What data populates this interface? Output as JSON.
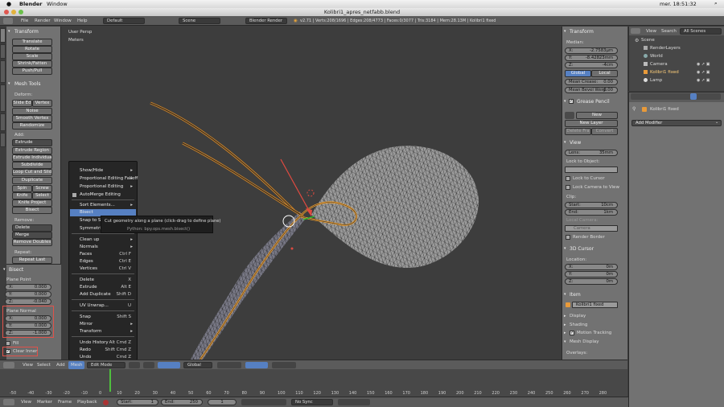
{
  "mac": {
    "app": "Blender",
    "menu_window": "Window",
    "title": "Kolibri1_apres_netfabb.blend",
    "clock": "mer. 18:51:32"
  },
  "info": {
    "menu": [
      "File",
      "Render",
      "Window",
      "Help"
    ],
    "layout": "Default",
    "scene": "Scene",
    "engine": "Blender Render",
    "stats": "v2.71 | Verts:208/1696 | Edges:208/4773 | Faces:0/3077 | Tris:3184 | Mem:28.13M | Kolibri1 fixed"
  },
  "vtabs": [
    "Tools",
    "Create",
    "Relations",
    "Shading / UVs",
    "Options",
    "Grease Pencil"
  ],
  "tool": {
    "transform_hdr": "Transform",
    "transform": [
      "Translate",
      "Rotate",
      "Scale",
      "Shrink/Fatten",
      "Push/Pull"
    ],
    "mesh_hdr": "Mesh Tools",
    "deform": "Deform:",
    "slide_edge": "Slide Ed",
    "vertex": "Vertex",
    "noise": "Noise",
    "smooth": "Smooth Vertex",
    "randomize": "Randomize",
    "add": "Add:",
    "extrude": "Extrude",
    "extrude_region": "Extrude Region",
    "extrude_individual": "Extrude Individual",
    "subdivide": "Subdivide",
    "loop_cut": "Loop Cut and Slide",
    "duplicate": "Duplicate",
    "spin": "Spin",
    "screw": "Screw",
    "knife": "Knife",
    "select": "Select",
    "knife_project": "Knife Project",
    "bisect": "Bisect",
    "remove": "Remove:",
    "delete": "Delete",
    "merge": "Merge",
    "remove_doubles": "Remove Doubles",
    "repeat": "Repeat:",
    "repeat_last": "Repeat Last"
  },
  "bisect": {
    "hdr": "Bisect",
    "plane_point": "Plane Point",
    "pp": [
      {
        "k": "X:",
        "v": "0.000"
      },
      {
        "k": "Y:",
        "v": "0.000"
      },
      {
        "k": "Z:",
        "v": "-0.040"
      }
    ],
    "plane_normal": "Plane Normal",
    "pn": [
      {
        "k": "X:",
        "v": "0.000"
      },
      {
        "k": "Y:",
        "v": "0.000"
      },
      {
        "k": "Z:",
        "v": "-1.000"
      }
    ],
    "fill": "Fill",
    "clear_inner": "Clear Inner"
  },
  "viewport": {
    "persp": "User Persp",
    "units": "Meters"
  },
  "menu": {
    "items": [
      {
        "label": "Show/Hide",
        "sc": "",
        "ar": "▸"
      },
      {
        "label": "Proportional Editing Falloff",
        "sc": "",
        "ar": "▸"
      },
      {
        "label": "Proportional Editing",
        "sc": "",
        "ar": "▸"
      },
      {
        "label": "AutoMerge Editing",
        "sc": "",
        "ar": ""
      },
      {
        "label": "Sort Elements...",
        "sc": "",
        "ar": "▸"
      },
      {
        "label": "Bisect",
        "sc": "",
        "ar": ""
      },
      {
        "label": "Snap to S",
        "sc": "",
        "ar": ""
      },
      {
        "label": "Symmetri",
        "sc": "",
        "ar": ""
      },
      {
        "label": "Clean up",
        "sc": "",
        "ar": "▸"
      },
      {
        "label": "Normals",
        "sc": "",
        "ar": "▸"
      },
      {
        "label": "Faces",
        "sc": "Ctrl F",
        "ar": ""
      },
      {
        "label": "Edges",
        "sc": "Ctrl E",
        "ar": ""
      },
      {
        "label": "Vertices",
        "sc": "Ctrl V",
        "ar": ""
      },
      {
        "label": "Delete",
        "sc": "X",
        "ar": ""
      },
      {
        "label": "Extrude",
        "sc": "Alt E",
        "ar": ""
      },
      {
        "label": "Add Duplicate",
        "sc": "Shift D",
        "ar": ""
      },
      {
        "label": "UV Unwrap...",
        "sc": "U",
        "ar": ""
      },
      {
        "label": "Snap",
        "sc": "Shift S",
        "ar": ""
      },
      {
        "label": "Mirror",
        "sc": "",
        "ar": "▸"
      },
      {
        "label": "Transform",
        "sc": "",
        "ar": "▸"
      },
      {
        "label": "Undo History",
        "sc": "Alt Cmd Z",
        "ar": ""
      },
      {
        "label": "Redo",
        "sc": "Shift Cmd Z",
        "ar": ""
      },
      {
        "label": "Undo",
        "sc": "Cmd Z",
        "ar": ""
      }
    ],
    "tooltip": "Cut geometry along a plane (click-drag to define plane)",
    "tooltip_python": "Python: bpy.ops.mesh.bisect()"
  },
  "v3dheader": {
    "view": "View",
    "select": "Select",
    "add": "Add",
    "mesh": "Mesh",
    "mode": "Edit Mode",
    "orientation": "Global"
  },
  "props": {
    "transform_hdr": "Transform",
    "median": "Median:",
    "x": {
      "k": "X:",
      "v": "-2.7583µm"
    },
    "y": {
      "k": "Y:",
      "v": "-8.42823mm"
    },
    "z": {
      "k": "Z:",
      "v": "-4cm"
    },
    "global": "Global",
    "local": "Local",
    "crease": {
      "k": "Mean Crease:",
      "v": "0.00"
    },
    "bevel": {
      "k": "Mean Bevel Weig:",
      "v": "0.00"
    },
    "gp_hdr": "Grease Pencil",
    "new": "New",
    "new_layer": "New Layer",
    "delete_fra": "Delete Fra",
    "convert": "Convert",
    "view_hdr": "View",
    "lens": {
      "k": "Lens:",
      "v": "35mm"
    },
    "lock_obj": "Lock to Object:",
    "lock_cursor": "Lock to Cursor",
    "lock_cam": "Lock Camera to View",
    "clip": "Clip:",
    "start": {
      "k": "Start:",
      "v": "10cm"
    },
    "end": {
      "k": "End:",
      "v": "1km"
    },
    "local_camera": "Local Camera:",
    "camera": "Camera",
    "render_border": "Render Border",
    "cursor_hdr": "3D Cursor",
    "location": "Location:",
    "cx": {
      "k": "X:",
      "v": "0m"
    },
    "cy": {
      "k": "Y:",
      "v": "0m"
    },
    "cz": {
      "k": "Z:",
      "v": "0m"
    },
    "item_hdr": "Item",
    "item_name": "Kolibri1 fixed",
    "display": "Display",
    "shading": "Shading",
    "motion": "Motion Tracking",
    "mesh_display": "Mesh Display",
    "overlays": "Overlays:"
  },
  "outliner": {
    "view": "View",
    "search": "Search",
    "all_scenes": "All Scenes",
    "items": [
      "Scene",
      "RenderLayers",
      "World",
      "Camera",
      "Kolibri1 fixed",
      "Lamp"
    ]
  },
  "properties": {
    "object": "Kolibri1 fixed",
    "add_modifier": "Add Modifier"
  },
  "timeline": {
    "ticks": [
      "-50",
      "-40",
      "-30",
      "-20",
      "-10",
      "0",
      "10",
      "20",
      "30",
      "40",
      "50",
      "60",
      "70",
      "80",
      "90",
      "100",
      "110",
      "120",
      "130",
      "140",
      "150",
      "160",
      "170",
      "180",
      "190",
      "200",
      "210",
      "220",
      "230",
      "240",
      "250",
      "260",
      "270",
      "280"
    ],
    "view": "View",
    "marker": "Marker",
    "frame": "Frame",
    "playback": "Playback",
    "start": {
      "k": "Start:",
      "v": "1"
    },
    "end": {
      "k": "End:",
      "v": "250"
    },
    "current": "1",
    "sync": "No Sync"
  }
}
